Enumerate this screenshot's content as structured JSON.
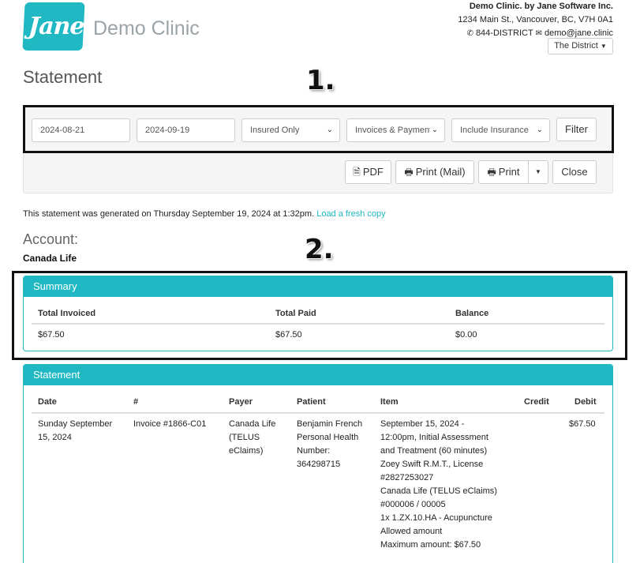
{
  "header": {
    "logo_text": "Jane",
    "clinic_name": "Demo Clinic",
    "company": "Demo Clinic. by Jane Software Inc.",
    "address": "1234 Main St., Vancouver, BC, V7H 0A1",
    "phone": "844-DISTRICT",
    "email": "demo@jane.clinic",
    "location": "The District"
  },
  "page_title": "Statement",
  "annotations": [
    "1.",
    "2."
  ],
  "filters": {
    "start_date": "2024-08-21",
    "end_date": "2024-09-19",
    "insured": "Insured Only",
    "type": "Invoices & Payments",
    "insurance": "Include Insurance",
    "filter_label": "Filter"
  },
  "actions": {
    "pdf": "PDF",
    "print_mail": "Print (Mail)",
    "print": "Print",
    "close": "Close"
  },
  "generated": {
    "text": "This statement was generated on Thursday September 19, 2024 at 1:32pm.",
    "link": "Load a fresh copy"
  },
  "account": {
    "label": "Account:",
    "name": "Canada Life"
  },
  "summary": {
    "title": "Summary",
    "headers": [
      "Total Invoiced",
      "Total Paid",
      "Balance"
    ],
    "values": [
      "$67.50",
      "$67.50",
      "$0.00"
    ]
  },
  "statement": {
    "title": "Statement",
    "headers": [
      "Date",
      "#",
      "Payer",
      "Patient",
      "Item",
      "Credit",
      "Debit"
    ],
    "rows": [
      {
        "date_lines": [
          "Sunday September",
          "15, 2024"
        ],
        "number": "Invoice #1866-C01",
        "payer_lines": [
          "Canada Life",
          "(TELUS",
          "eClaims)"
        ],
        "patient_lines": [
          "Benjamin French",
          "Personal Health",
          "Number:",
          "364298715"
        ],
        "item_lines": [
          "September 15, 2024 -",
          "12:00pm, Initial Assessment",
          "and Treatment (60 minutes)",
          "Zoey Swift R.M.T., License",
          "#2827253027",
          "Canada Life (TELUS eClaims)",
          "#000006 / 00005",
          "1x 1.ZX.10.HA - Acupuncture",
          "Allowed amount",
          "Maximum amount: $67.50"
        ],
        "credit": "",
        "debit": "$67.50"
      }
    ]
  },
  "colors": {
    "accent": "#1fb8c3",
    "highlight_border": "#111111"
  }
}
